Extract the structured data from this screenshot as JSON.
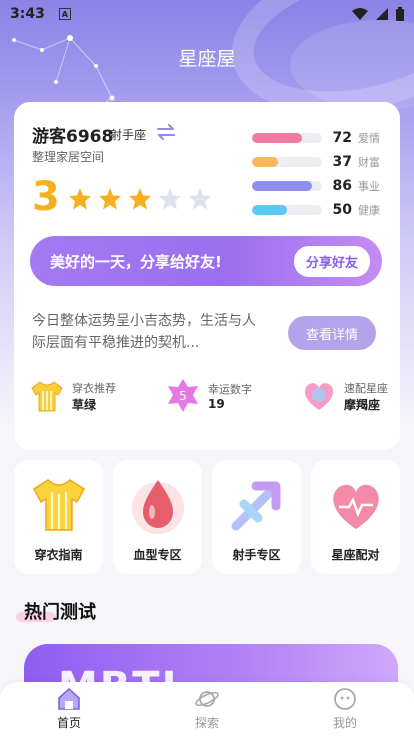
{
  "status_bar": {
    "time": "3:43",
    "notif": "A"
  },
  "app": {
    "title": "星座屋"
  },
  "profile": {
    "name": "游客6968",
    "zodiac": "射手座",
    "subtitle": "整理家居空间",
    "score": "3",
    "stars_filled": 3,
    "stars_total": 5
  },
  "fortune_bars": [
    {
      "value": "72",
      "label": "爱情",
      "color": "#f07aa0"
    },
    {
      "value": "37",
      "label": "财富",
      "color": "#f9b85c"
    },
    {
      "value": "86",
      "label": "事业",
      "color": "#8f8ff0"
    },
    {
      "value": "50",
      "label": "健康",
      "color": "#5cc8f2"
    }
  ],
  "share": {
    "text": "美好的一天，分享给好友!",
    "button": "分享好友"
  },
  "fortune": {
    "text": "今日整体运势呈小吉态势，生活与人际层面有平稳推进的契机...",
    "button": "查看详情"
  },
  "tips": [
    {
      "label": "穿衣推荐",
      "value": "草绿",
      "icon": "shirt-icon"
    },
    {
      "label": "幸运数字",
      "value": "19",
      "icon": "lucky-number-icon",
      "badge": "5"
    },
    {
      "label": "速配星座",
      "value": "摩羯座",
      "icon": "match-icon"
    }
  ],
  "features": [
    {
      "label": "穿衣指南",
      "icon": "shirt-icon"
    },
    {
      "label": "血型专区",
      "icon": "blood-drop-icon"
    },
    {
      "label": "射手专区",
      "icon": "sagittarius-icon"
    },
    {
      "label": "星座配对",
      "icon": "heart-icon"
    }
  ],
  "hot": {
    "title": "热门测试",
    "banner": "MBTI"
  },
  "tabs": [
    {
      "label": "首页",
      "icon": "home-icon",
      "active": true
    },
    {
      "label": "探索",
      "icon": "planet-icon",
      "active": false
    },
    {
      "label": "我的",
      "icon": "profile-icon",
      "active": false
    }
  ]
}
